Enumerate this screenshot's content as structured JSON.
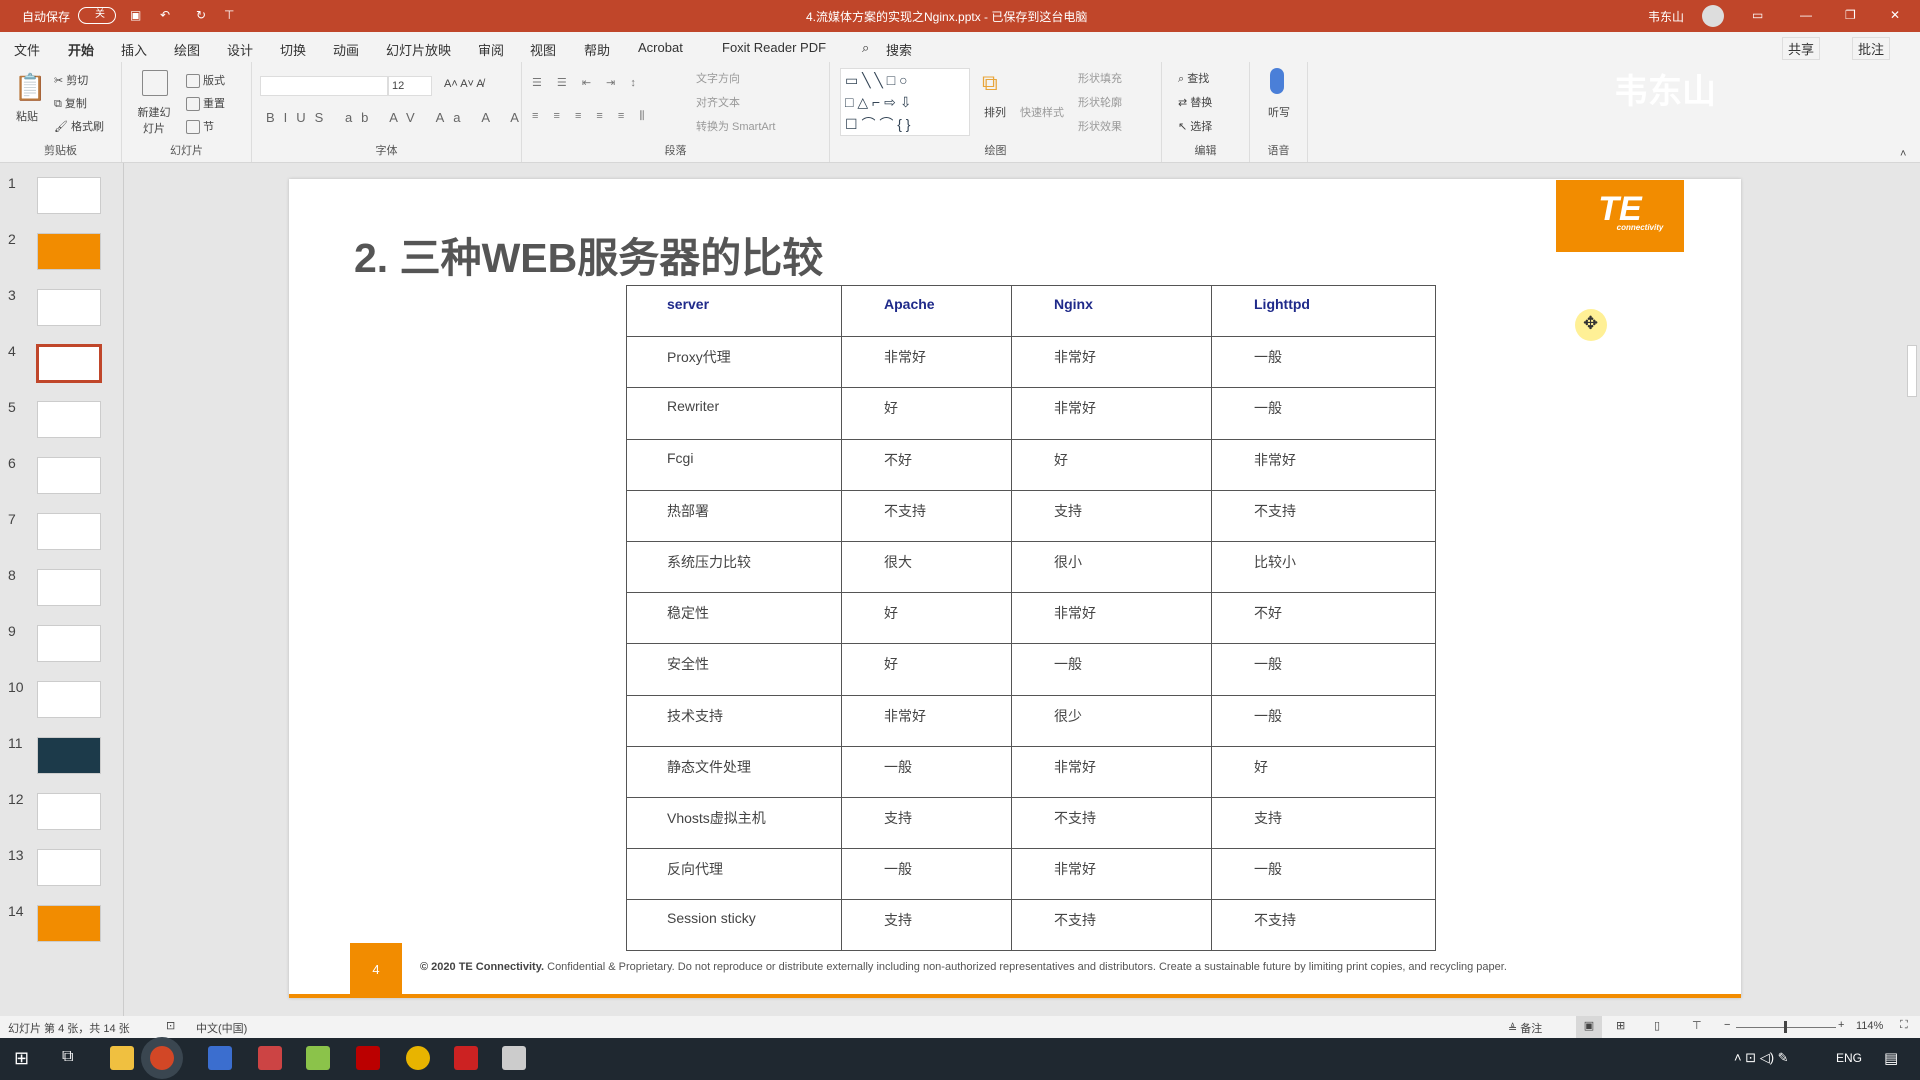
{
  "titlebar": {
    "autosave": "自动保存",
    "autosave_state": "关",
    "doc_title": "4.流媒体方案的实现之Nginx.pptx - 已保存到这台电脑",
    "user": "韦东山"
  },
  "menu": {
    "tabs": [
      "文件",
      "开始",
      "插入",
      "绘图",
      "设计",
      "切换",
      "动画",
      "幻灯片放映",
      "审阅",
      "视图",
      "帮助",
      "Acrobat",
      "Foxit Reader PDF"
    ],
    "active": "开始",
    "search": "搜索",
    "share": "共享",
    "comment": "批注"
  },
  "ribbon": {
    "clipboard": {
      "label": "剪贴板",
      "paste": "粘贴",
      "cut": "剪切",
      "copy": "复制",
      "format_painter": "格式刷"
    },
    "slides": {
      "label": "幻灯片",
      "new_slide": "新建幻灯片",
      "layout": "版式",
      "reset": "重置",
      "section": "节"
    },
    "font": {
      "label": "字体",
      "font_size": "12"
    },
    "paragraph": {
      "label": "段落",
      "text_direction": "文字方向",
      "align_text": "对齐文本",
      "smartart": "转换为 SmartArt"
    },
    "drawing": {
      "label": "绘图",
      "arrange": "排列",
      "quick_styles": "快速样式",
      "shape_fill": "形状填充",
      "shape_outline": "形状轮廓",
      "shape_effects": "形状效果"
    },
    "editing": {
      "label": "编辑",
      "find": "查找",
      "replace": "替换",
      "select": "选择"
    },
    "voice": {
      "label": "语音",
      "dictate": "听写"
    },
    "watermark": "韦东山"
  },
  "thumbnails": [
    "1",
    "2",
    "3",
    "4",
    "5",
    "6",
    "7",
    "8",
    "9",
    "10",
    "11",
    "12",
    "13",
    "14"
  ],
  "active_slide": 4,
  "slide": {
    "title": "2. 三种WEB服务器的比较",
    "logo": "TE",
    "logo_sub": "connectivity",
    "table": {
      "header": [
        "server",
        "Apache",
        "Nginx",
        "Lighttpd"
      ],
      "rows": [
        [
          "Proxy代理",
          "非常好",
          "非常好",
          "一般"
        ],
        [
          "Rewriter",
          "好",
          "非常好",
          "一般"
        ],
        [
          "Fcgi",
          "不好",
          "好",
          "非常好"
        ],
        [
          "热部署",
          "不支持",
          "支持",
          "不支持"
        ],
        [
          "系统压力比较",
          "很大",
          "很小",
          "比较小"
        ],
        [
          "稳定性",
          "好",
          "非常好",
          "不好"
        ],
        [
          "安全性",
          "好",
          "一般",
          "一般"
        ],
        [
          "技术支持",
          "非常好",
          "很少",
          "一般"
        ],
        [
          "静态文件处理",
          "一般",
          "非常好",
          "好"
        ],
        [
          "Vhosts虚拟主机",
          "支持",
          "不支持",
          "支持"
        ],
        [
          "反向代理",
          "一般",
          "非常好",
          "一般"
        ],
        [
          "Session sticky",
          "支持",
          "不支持",
          "不支持"
        ]
      ]
    },
    "page_number": "4",
    "footer_bold": "© 2020 TE Connectivity.",
    "footer_text": "Confidential & Proprietary. Do not reproduce or distribute externally including non-authorized representatives and distributors. Create a sustainable future by limiting print copies, and recycling paper."
  },
  "status": {
    "slide_info": "幻灯片 第 4 张，共 14 张",
    "language": "中文(中国)",
    "notes": "备注",
    "zoom": "114%"
  },
  "taskbar": {
    "lang": "ENG"
  },
  "colors": {
    "accent": "#c0462a",
    "orange": "#f28c00",
    "header_text": "#1f2a8a"
  }
}
